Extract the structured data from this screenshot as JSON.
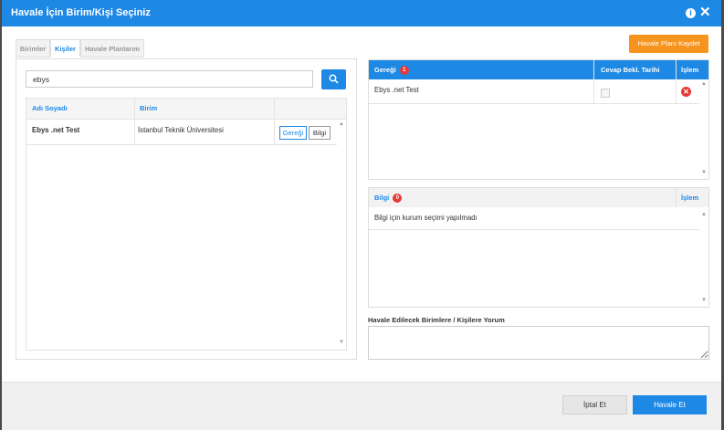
{
  "dialog": {
    "title": "Havale İçin Birim/Kişi Seçiniz",
    "info_icon": "i",
    "close_icon": "✕"
  },
  "tabs": [
    {
      "label": "Birimler",
      "active": false
    },
    {
      "label": "Kişiler",
      "active": true
    },
    {
      "label": "Havale Planlarım",
      "active": false
    }
  ],
  "search": {
    "value": "ebys",
    "placeholder": ""
  },
  "results": {
    "columns": [
      "Adı Soyadı",
      "Birim"
    ],
    "rows": [
      {
        "name": "Ebys .net Test",
        "unit": "İstanbul Teknik Üniversitesi",
        "btn_geregi": "Gereği",
        "btn_bilgi": "Bilgi"
      }
    ]
  },
  "plan_button": "Havale Planı Kaydet",
  "geregi": {
    "header": "Gereği",
    "badge": "1",
    "col_tarih": "Cevap Bekl. Tarihi",
    "col_islem": "İşlem",
    "rows": [
      {
        "name": "Ebys .net Test"
      }
    ]
  },
  "bilgi": {
    "header": "Bilgi",
    "badge": "0",
    "col_islem": "İşlem",
    "empty_text": "Bilgi için kurum seçimi yapılmadı"
  },
  "yorum": {
    "label": "Havale Edilecek Birimlere / Kişilere Yorum",
    "value": ""
  },
  "footer": {
    "cancel": "İptal Et",
    "submit": "Havale Et"
  },
  "colors": {
    "primary": "#1e88e5",
    "orange": "#f7941d",
    "danger": "#e53935"
  },
  "icons": {
    "search": "search-icon",
    "close": "close-icon",
    "info": "info-icon",
    "remove": "remove-icon"
  }
}
